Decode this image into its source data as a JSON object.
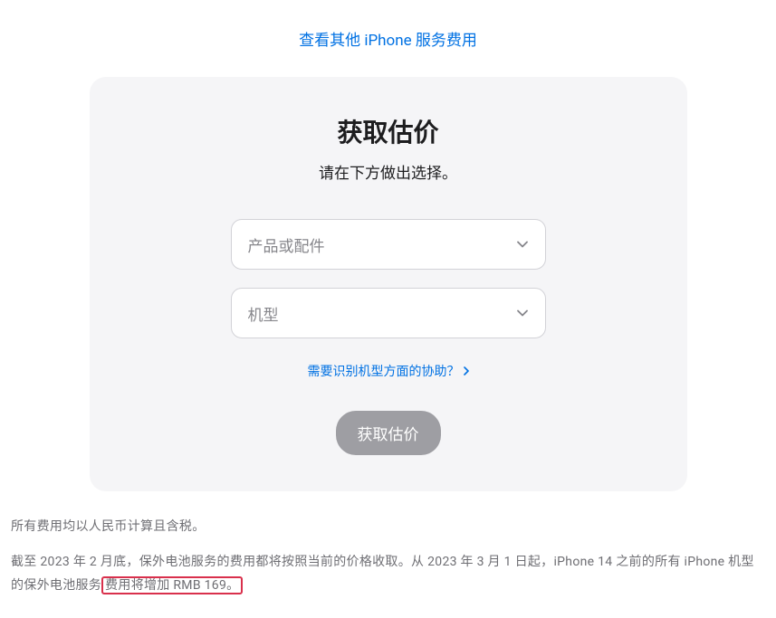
{
  "topLink": "查看其他 iPhone 服务费用",
  "panel": {
    "title": "获取估价",
    "subtitle": "请在下方做出选择。",
    "selector1": {
      "placeholder": "产品或配件"
    },
    "selector2": {
      "placeholder": "机型"
    },
    "helpLink": "需要识别机型方面的协助？",
    "submit": "获取估价"
  },
  "notes": {
    "line1": "所有费用均以人民币计算且含税。",
    "line2_part1": "截至 2023 年 2 月底，保外电池服务的费用都将按照当前的价格收取。从 2023 年 3 月 1 日起，iPhone 14 之前的所有 iPhone 机型的保外电池服务",
    "line2_highlight": "费用将增加 RMB 169。"
  }
}
